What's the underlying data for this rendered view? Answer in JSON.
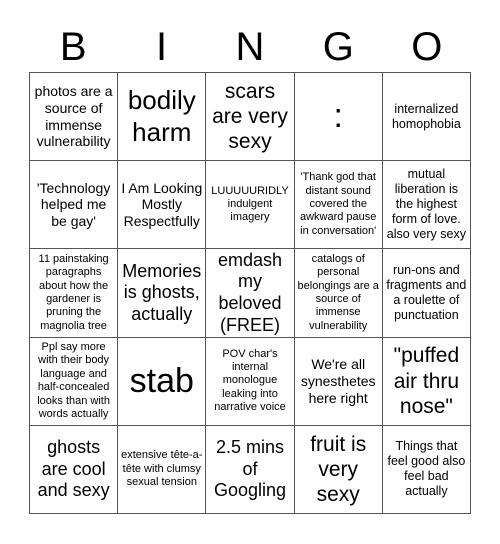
{
  "header": {
    "letters": [
      "B",
      "I",
      "N",
      "G",
      "O"
    ]
  },
  "card": {
    "rows": [
      [
        {
          "text": "photos are a source of immense vulnerability"
        },
        {
          "text": "bodily harm"
        },
        {
          "text": "scars are very sexy"
        },
        {
          "text": ":"
        },
        {
          "text": "internalized homophobia"
        }
      ],
      [
        {
          "text": "'Technology helped me be gay'"
        },
        {
          "text": "I Am Looking Mostly Respectfully"
        },
        {
          "text": "LUUUUURIDLY indulgent imagery"
        },
        {
          "text": "'Thank god that distant sound covered the awkward pause in conversation'"
        },
        {
          "text": "mutual liberation is the highest form of love. also very sexy"
        }
      ],
      [
        {
          "text": "11 painstaking paragraphs about how the gardener is pruning the magnolia tree"
        },
        {
          "text": "Memories is ghosts, actually"
        },
        {
          "text": "emdash my beloved (FREE)"
        },
        {
          "text": "catalogs of personal belongings are a source of immense vulnerability"
        },
        {
          "text": "run-ons and fragments and a roulette of punctuation"
        }
      ],
      [
        {
          "text": "Ppl say more with their body language and half-concealed looks than with words actually"
        },
        {
          "text": "stab"
        },
        {
          "text": "POV char's internal monologue leaking into narrative voice"
        },
        {
          "text": "We're all synesthetes here right"
        },
        {
          "text": "\"puffed air thru nose\""
        }
      ],
      [
        {
          "text": "ghosts are cool and sexy"
        },
        {
          "text": "extensive tête-a-tête with clumsy sexual tension"
        },
        {
          "text": "2.5 mins of Googling"
        },
        {
          "text": "fruit is very sexy"
        },
        {
          "text": "Things that feel good also feel bad actually"
        }
      ]
    ]
  }
}
